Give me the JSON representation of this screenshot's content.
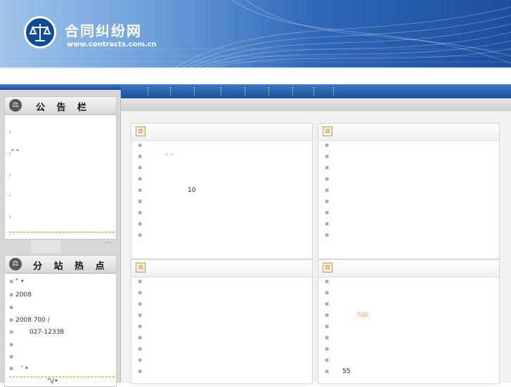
{
  "header": {
    "site_title": "合同纠纷网",
    "site_url": "www.contracts.com.cn",
    "logo_icon": "scales-icon"
  },
  "colors": {
    "banner_dark": "#1d4f9e",
    "nav_blue": "#2a5fae",
    "accent_orange": "#f29a1f"
  },
  "sidebar": {
    "notice": {
      "title": "公 告 栏",
      "lines": [
        ".",
        ".\" \"",
        ".",
        ".",
        "."
      ],
      "more": "···"
    },
    "hot": {
      "title": "分 站 热 点",
      "lines": [
        "\" •",
        "2008",
        "",
        "2008          700 /",
        "027-12338",
        "",
        "",
        "' •",
        "\"\\/•"
      ]
    }
  },
  "panels": [
    {
      "rows": [
        "",
        "\" \"",
        "",
        "10",
        "",
        "",
        "",
        "",
        ""
      ]
    },
    {
      "rows": [
        "",
        "",
        "",
        "",
        "",
        "",
        "",
        "",
        ""
      ]
    },
    {
      "rows": [
        "",
        "",
        "",
        "",
        "",
        "",
        "",
        "",
        ""
      ]
    },
    {
      "rows": [
        "",
        "",
        "",
        "700",
        "",
        "",
        "",
        "",
        "55"
      ]
    }
  ]
}
